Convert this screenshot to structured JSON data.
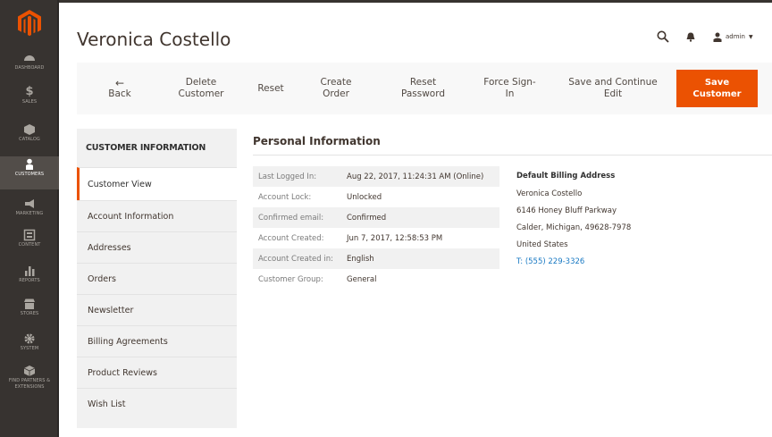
{
  "header": {
    "title": "Veronica Costello",
    "user": "admin"
  },
  "nav": [
    {
      "label": "Dashboard",
      "icon": "dashboard-icon"
    },
    {
      "label": "Sales",
      "icon": "dollar-icon"
    },
    {
      "label": "Catalog",
      "icon": "cube-icon"
    },
    {
      "label": "Customers",
      "icon": "person-icon"
    },
    {
      "label": "Marketing",
      "icon": "megaphone-icon"
    },
    {
      "label": "Content",
      "icon": "content-icon"
    },
    {
      "label": "Reports",
      "icon": "bar-chart-icon"
    },
    {
      "label": "Stores",
      "icon": "store-icon"
    },
    {
      "label": "System",
      "icon": "gear-icon"
    },
    {
      "label": "Find Partners & Extensions",
      "icon": "box-icon"
    }
  ],
  "actions": {
    "back": "Back",
    "delete": "Delete\nCustomer",
    "reset": "Reset",
    "create_order": "Create\nOrder",
    "reset_password": "Reset\nPassword",
    "force_signin": "Force Sign-\nIn",
    "save_continue": "Save and Continue\nEdit",
    "save": "Save\nCustomer"
  },
  "tabs": {
    "title": "CUSTOMER INFORMATION",
    "items": [
      "Customer View",
      "Account Information",
      "Addresses",
      "Orders",
      "Newsletter",
      "Billing Agreements",
      "Product Reviews",
      "Wish List"
    ]
  },
  "personal": {
    "title": "Personal Information",
    "rows": [
      {
        "k": "Last Logged In:",
        "v": "Aug 22, 2017, 11:24:31 AM (Online)"
      },
      {
        "k": "Account Lock:",
        "v": "Unlocked"
      },
      {
        "k": "Confirmed email:",
        "v": "Confirmed"
      },
      {
        "k": "Account Created:",
        "v": "Jun 7, 2017, 12:58:53 PM"
      },
      {
        "k": "Account Created in:",
        "v": "English"
      },
      {
        "k": "Customer Group:",
        "v": "General"
      }
    ]
  },
  "billing": {
    "heading": "Default Billing Address",
    "lines": [
      "Veronica Costello",
      "6146 Honey Bluff Parkway",
      "Calder, Michigan, 49628-7978",
      "United States"
    ],
    "phone": "T: (555) 229-3326"
  },
  "colors": {
    "accent": "#eb5202",
    "nav_bg": "#373330",
    "link": "#1979c3"
  }
}
